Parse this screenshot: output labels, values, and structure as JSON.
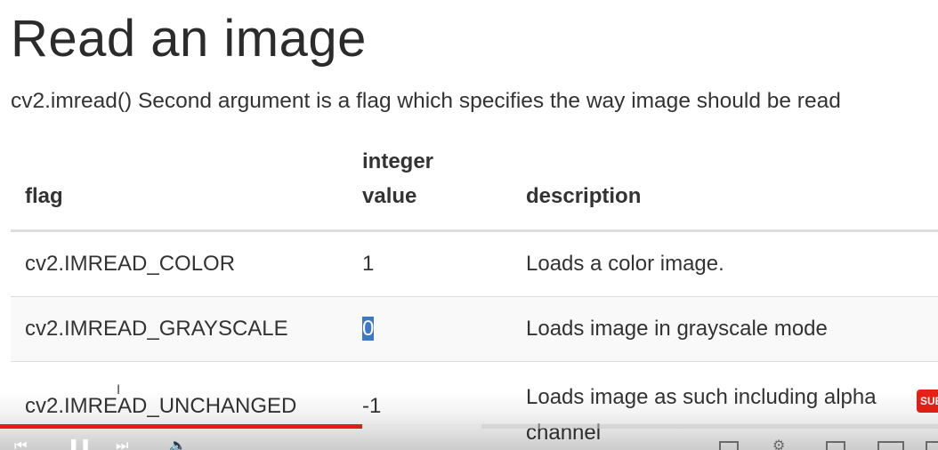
{
  "page": {
    "title": "Read an image",
    "intro": "cv2.imread() Second argument is a flag which specifies the way image should be read"
  },
  "table": {
    "headers": {
      "flag": "flag",
      "value_line1": "integer",
      "value_line2": "value",
      "description": "description"
    },
    "rows": [
      {
        "flag": "cv2.IMREAD_COLOR",
        "value": "1",
        "description": "Loads a color image."
      },
      {
        "flag": "cv2.IMREAD_GRAYSCALE",
        "value": "0",
        "description": "Loads image in grayscale mode"
      },
      {
        "flag": "cv2.IMREAD_UNCHANGED",
        "value": "-1",
        "description_line1": "Loads image as such including alpha",
        "description_line2": "channel"
      }
    ]
  },
  "overlay": {
    "subscribe_badge": "SUB"
  },
  "player": {
    "played_fraction": 0.386,
    "buffered_fraction": 0.513,
    "progress_color": "#e21b1b",
    "icons": [
      "skip-back-icon",
      "pause-icon",
      "skip-next-icon",
      "volume-icon",
      "subtitles-icon",
      "settings-icon",
      "miniplayer-icon",
      "theater-icon",
      "fullscreen-icon"
    ]
  },
  "colors": {
    "selection": "#3d78c8",
    "row_stripe": "#f9f9f9",
    "border": "#dddddd"
  }
}
